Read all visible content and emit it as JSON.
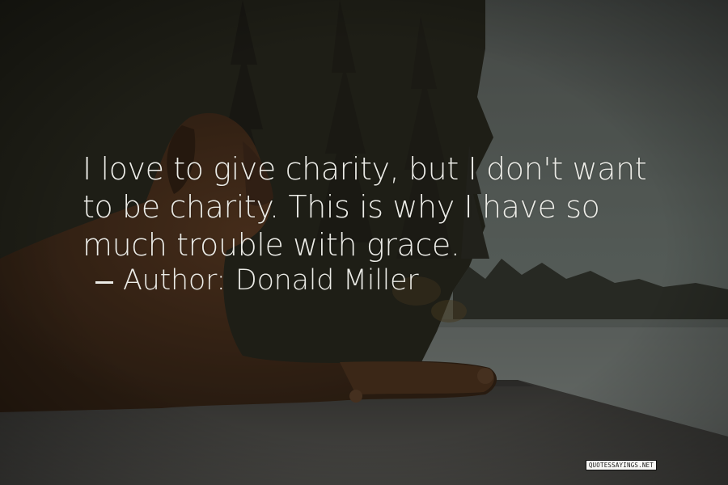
{
  "quote": {
    "text": "I love to give charity, but I don't want to be charity. This is why I have so much trouble with grace.",
    "author_prefix": "Author:",
    "author_name": "Donald Miller"
  },
  "watermark": {
    "text": "QUOTESSAYINGS.NET"
  },
  "colors": {
    "text": "#ebebe6",
    "sky": "#7f8983",
    "forest": "#2f2e23",
    "water": "#8e9691",
    "dog": "#5a3a22",
    "deck": "#5b5a55"
  },
  "icons": {
    "author_marker": "dash-icon",
    "subject": "dog-silhouette"
  }
}
